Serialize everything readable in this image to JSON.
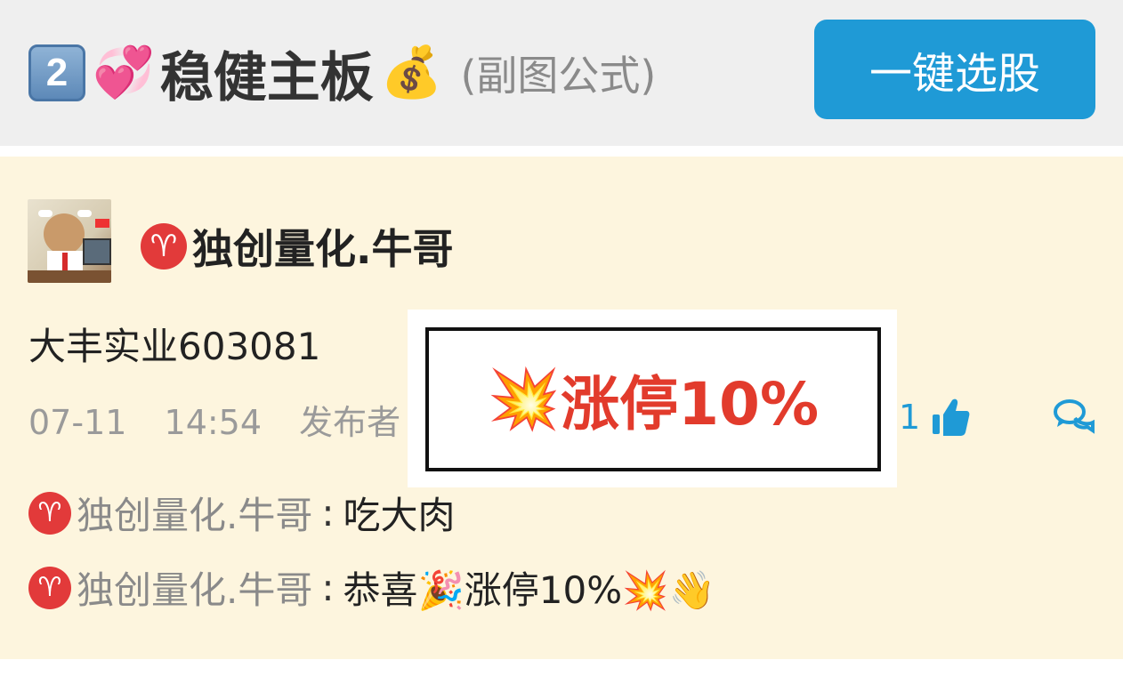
{
  "header": {
    "number_badge": "2",
    "hearts_emoji": "💞",
    "title": "稳健主板",
    "money_emoji": "💰",
    "subtitle": "(副图公式)",
    "select_button_label": "一键选股"
  },
  "post": {
    "author_badge": "♈",
    "author_name": "独创量化.牛哥",
    "stock": "大丰实业603081",
    "date": "07-11",
    "time": "14:54",
    "publisher_label": "发布者",
    "like_count": "1",
    "comments": [
      {
        "badge": "♈",
        "name": "独创量化.牛哥",
        "colon": ":",
        "text": "吃大肉"
      },
      {
        "badge": "♈",
        "name": "独创量化.牛哥",
        "colon": ":",
        "text": "恭喜🎉涨停10%💥👋"
      }
    ]
  },
  "overlay": {
    "emoji": "💥",
    "text": "涨停10%"
  },
  "colors": {
    "accent": "#1f9ad6",
    "post_background": "#fdf5de",
    "header_background": "#efefef",
    "limit_up_red": "#e23b2c"
  }
}
